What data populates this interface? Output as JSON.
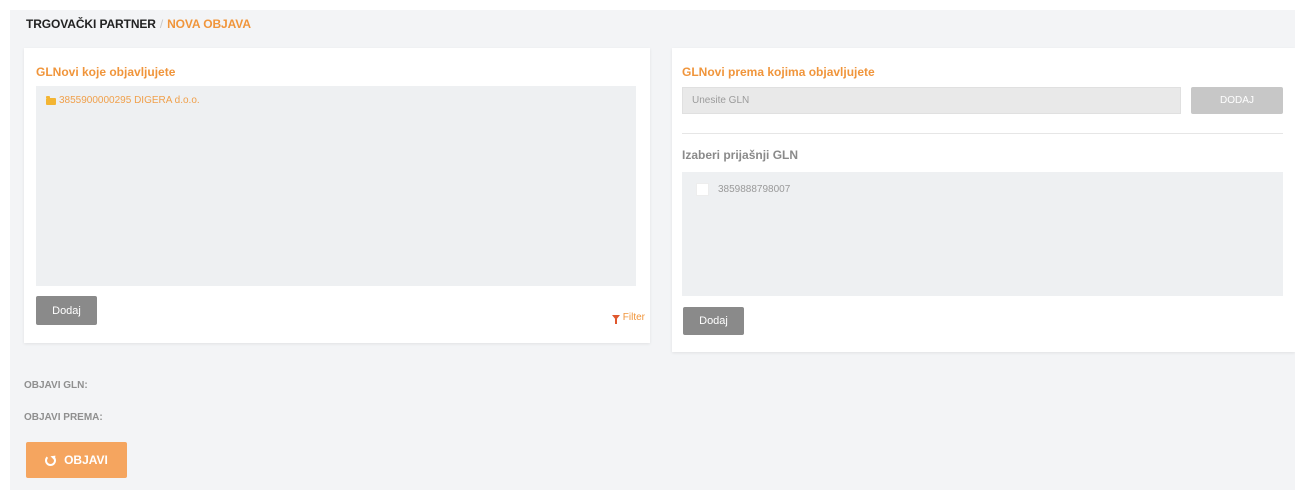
{
  "breadcrumb": {
    "root": "TRGOVAČKI PARTNER",
    "separator": "/",
    "current": "NOVA OBJAVA"
  },
  "left_panel": {
    "title": "GLNovi koje objavljujete",
    "items": [
      {
        "icon": "folder-icon",
        "label": "3855900000295 DIGERA d.o.o."
      }
    ],
    "add_button": "Dodaj",
    "filter_link": "Filter",
    "filter_icon": "filter-icon"
  },
  "right_panel": {
    "title": "GLNovi prema kojima objavljujete",
    "gln_input": {
      "value": "",
      "placeholder": "Unesite GLN"
    },
    "add_gln_button": "DODAJ",
    "previous_title": "Izaberi prijašnji GLN",
    "previous_items": [
      {
        "label": "3859888798007",
        "checked": false
      }
    ],
    "add_button": "Dodaj"
  },
  "footer": {
    "objavi_gln_label": "OBJAVI GLN:",
    "objavi_prema_label": "OBJAVI PREMA:",
    "publish_button": "OBJAVI",
    "publish_icon": "refresh-icon"
  },
  "colors": {
    "accent": "#f0953b",
    "publish_button": "#f5a55f",
    "gray_button": "#8a8a8a",
    "background": "#f3f4f6"
  }
}
